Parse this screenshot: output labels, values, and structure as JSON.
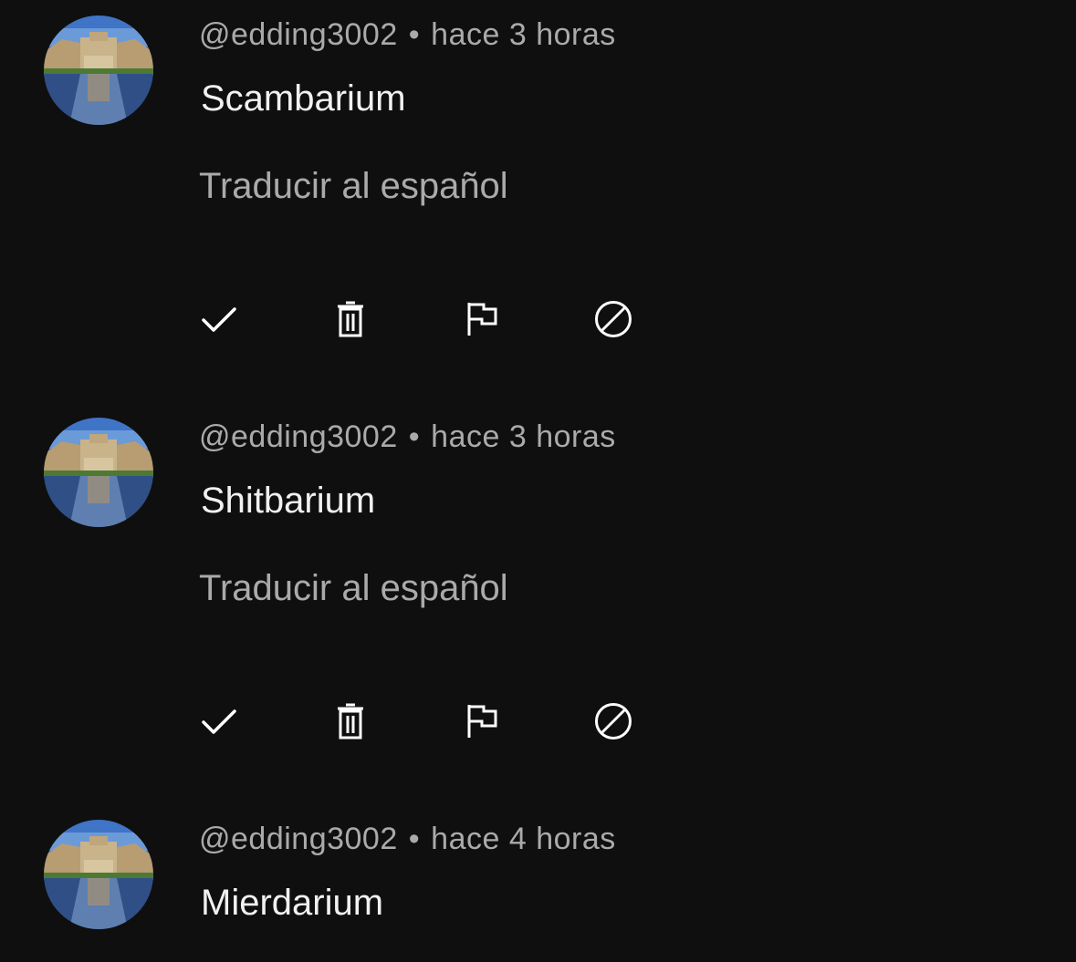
{
  "comments": [
    {
      "author": "@edding3002",
      "separator": "•",
      "time": "hace 3 horas",
      "text": "Scambarium",
      "translate_label": "Traducir al español",
      "actions": [
        "check-icon",
        "trash-icon",
        "flag-icon",
        "block-icon"
      ]
    },
    {
      "author": "@edding3002",
      "separator": "•",
      "time": "hace 3 horas",
      "text": "Shitbarium",
      "translate_label": "Traducir al español",
      "actions": [
        "check-icon",
        "trash-icon",
        "flag-icon",
        "block-icon"
      ]
    },
    {
      "author": "@edding3002",
      "separator": "•",
      "time": "hace 4 horas",
      "text": "Mierdarium"
    }
  ],
  "colors": {
    "background": "#0f0f0f",
    "primary_text": "#f1f1f1",
    "secondary_text": "#aaaaaa",
    "icon": "#ffffff"
  }
}
